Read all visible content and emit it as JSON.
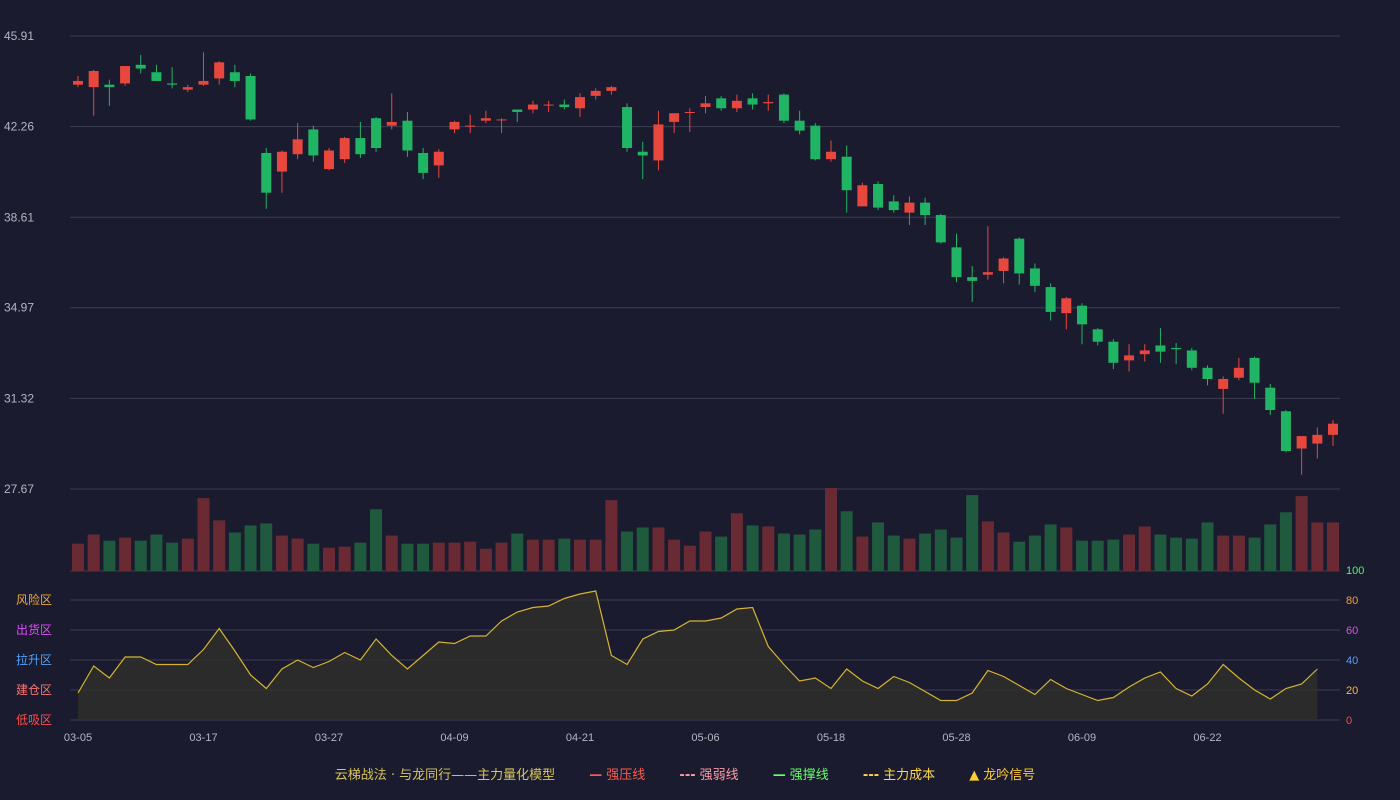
{
  "chart_data": {
    "type": "candlestick",
    "x_ticks": [
      "03-05",
      "03-17",
      "03-27",
      "04-09",
      "04-21",
      "05-06",
      "05-18",
      "05-28",
      "06-09",
      "06-22"
    ],
    "price_ticks": [
      "45.91",
      "42.26",
      "38.61",
      "34.97",
      "31.32",
      "27.67"
    ],
    "price_range": [
      27.67,
      45.91
    ],
    "osc_ticks": [
      "100",
      "80",
      "60",
      "40",
      "20",
      "0"
    ],
    "osc_range": [
      0,
      100
    ],
    "zones": [
      "风险区",
      "出货区",
      "拉升区",
      "建仓区",
      "低吸区"
    ],
    "ohlc": [
      [
        43.95,
        44.1,
        44.3,
        43.85
      ],
      [
        43.85,
        44.5,
        44.55,
        42.7
      ],
      [
        43.95,
        43.85,
        44.15,
        43.1
      ],
      [
        44.0,
        44.7,
        44.7,
        43.9
      ],
      [
        44.75,
        44.6,
        45.15,
        44.4
      ],
      [
        44.45,
        44.1,
        44.75,
        44.1
      ],
      [
        44.0,
        43.95,
        44.65,
        43.8
      ],
      [
        43.75,
        43.85,
        43.95,
        43.65
      ],
      [
        43.95,
        44.1,
        45.25,
        43.9
      ],
      [
        44.2,
        44.85,
        44.9,
        43.95
      ],
      [
        44.45,
        44.1,
        44.75,
        43.85
      ],
      [
        44.3,
        42.55,
        44.4,
        42.5
      ],
      [
        41.2,
        39.6,
        41.4,
        38.95
      ],
      [
        40.45,
        41.25,
        41.3,
        39.6
      ],
      [
        41.15,
        41.75,
        42.4,
        40.95
      ],
      [
        42.15,
        41.1,
        42.3,
        40.85
      ],
      [
        40.55,
        41.3,
        41.4,
        40.5
      ],
      [
        40.95,
        41.8,
        41.85,
        40.8
      ],
      [
        41.8,
        41.15,
        42.45,
        41.0
      ],
      [
        42.6,
        41.4,
        42.65,
        41.25
      ],
      [
        42.3,
        42.45,
        43.6,
        42.15
      ],
      [
        42.5,
        41.3,
        42.85,
        41.05
      ],
      [
        41.2,
        40.4,
        41.4,
        40.15
      ],
      [
        40.7,
        41.25,
        41.35,
        40.2
      ],
      [
        42.15,
        42.45,
        42.5,
        42.0
      ],
      [
        42.3,
        42.3,
        42.75,
        42.0
      ],
      [
        42.5,
        42.6,
        42.9,
        42.4
      ],
      [
        42.55,
        42.55,
        42.6,
        42.0
      ],
      [
        42.95,
        42.85,
        42.95,
        42.45
      ],
      [
        42.95,
        43.15,
        43.3,
        42.8
      ],
      [
        43.15,
        43.15,
        43.3,
        42.85
      ],
      [
        43.15,
        43.05,
        43.35,
        42.95
      ],
      [
        43.0,
        43.45,
        43.6,
        42.65
      ],
      [
        43.5,
        43.7,
        43.8,
        43.35
      ],
      [
        43.7,
        43.85,
        43.9,
        43.55
      ],
      [
        43.05,
        41.4,
        43.2,
        41.25
      ],
      [
        41.25,
        41.1,
        41.65,
        40.15
      ],
      [
        40.9,
        42.35,
        42.9,
        40.5
      ],
      [
        42.45,
        42.8,
        42.8,
        42.0
      ],
      [
        42.85,
        42.85,
        43.0,
        42.05
      ],
      [
        43.05,
        43.2,
        43.5,
        42.8
      ],
      [
        43.4,
        43.0,
        43.5,
        42.9
      ],
      [
        43.0,
        43.3,
        43.55,
        42.85
      ],
      [
        43.4,
        43.15,
        43.6,
        42.95
      ],
      [
        43.2,
        43.25,
        43.55,
        42.9
      ],
      [
        43.55,
        42.5,
        43.6,
        42.4
      ],
      [
        42.5,
        42.1,
        42.9,
        41.95
      ],
      [
        42.3,
        40.95,
        42.4,
        40.9
      ],
      [
        40.95,
        41.25,
        41.7,
        40.85
      ],
      [
        41.05,
        39.7,
        41.5,
        38.8
      ],
      [
        39.05,
        39.9,
        40.0,
        39.1
      ],
      [
        39.95,
        39.0,
        40.05,
        38.9
      ],
      [
        39.25,
        38.9,
        39.5,
        38.8
      ],
      [
        38.8,
        39.2,
        39.45,
        38.3
      ],
      [
        39.2,
        38.7,
        39.4,
        38.3
      ],
      [
        38.7,
        37.6,
        38.75,
        37.55
      ],
      [
        37.4,
        36.2,
        37.95,
        36.0
      ],
      [
        36.2,
        36.05,
        36.65,
        35.2
      ],
      [
        36.3,
        36.4,
        38.25,
        36.1
      ],
      [
        36.45,
        36.95,
        37.0,
        35.95
      ],
      [
        37.75,
        36.35,
        37.8,
        35.9
      ],
      [
        36.55,
        35.85,
        36.75,
        35.6
      ],
      [
        35.8,
        34.8,
        35.95,
        34.45
      ],
      [
        34.75,
        35.35,
        35.4,
        34.1
      ],
      [
        35.05,
        34.3,
        35.15,
        33.5
      ],
      [
        34.1,
        33.6,
        34.15,
        33.45
      ],
      [
        33.6,
        32.75,
        33.7,
        32.5
      ],
      [
        32.85,
        33.05,
        33.5,
        32.4
      ],
      [
        33.1,
        33.25,
        33.5,
        32.8
      ],
      [
        33.45,
        33.2,
        34.15,
        32.75
      ],
      [
        33.35,
        33.3,
        33.55,
        32.7
      ],
      [
        33.25,
        32.55,
        33.35,
        32.45
      ],
      [
        32.55,
        32.1,
        32.65,
        31.85
      ],
      [
        31.7,
        32.1,
        32.2,
        30.7
      ],
      [
        32.15,
        32.55,
        32.95,
        32.05
      ],
      [
        32.95,
        31.95,
        33.0,
        31.3
      ],
      [
        31.75,
        30.85,
        31.9,
        30.65
      ],
      [
        30.8,
        29.2,
        30.85,
        29.15
      ],
      [
        29.3,
        29.8,
        29.8,
        28.25
      ],
      [
        29.5,
        29.85,
        30.15,
        28.9
      ],
      [
        29.85,
        30.3,
        30.45,
        29.4
      ]
    ],
    "volume": [
      27,
      36,
      30,
      33,
      30,
      36,
      28,
      32,
      72,
      50,
      38,
      45,
      47,
      35,
      32,
      27,
      23,
      24,
      28,
      61,
      35,
      27,
      27,
      28,
      28,
      29,
      22,
      28,
      37,
      31,
      31,
      32,
      31,
      31,
      70,
      39,
      43,
      43,
      31,
      25,
      39,
      34,
      57,
      45,
      44,
      37,
      36,
      41,
      82,
      59,
      34,
      48,
      35,
      32,
      37,
      41,
      33,
      75,
      49,
      38,
      29,
      35,
      46,
      43,
      30,
      30,
      31,
      36,
      44,
      36,
      33,
      32,
      48,
      35,
      35,
      33,
      46,
      58,
      74,
      48,
      48
    ],
    "volume_max": 82,
    "oscillator": [
      18,
      36,
      28,
      42,
      42,
      37,
      37,
      37,
      47,
      61,
      46,
      30,
      21,
      34,
      40,
      35,
      39,
      45,
      40,
      54,
      43,
      34,
      43,
      52,
      51,
      56,
      56,
      66,
      72,
      75,
      76,
      81,
      84,
      86,
      43,
      37,
      54,
      59,
      60,
      66,
      66,
      68,
      74,
      75,
      49,
      37,
      26,
      28,
      21,
      34,
      26,
      21,
      29,
      25,
      19,
      13,
      13,
      18,
      33,
      29,
      23,
      17,
      27,
      21,
      17,
      13,
      15,
      22,
      28,
      32,
      21,
      16,
      24,
      37,
      28,
      20,
      14,
      21,
      24,
      34
    ],
    "colors": {
      "up": "#e8473e",
      "down": "#1fb564",
      "up_volume": "#6a2a33",
      "down_volume": "#1f5a3f",
      "oscillator_line": "#d6b42a",
      "oscillator_fill": "#2f2e2c",
      "grid": "#3c3e52"
    }
  },
  "legend": {
    "title": "云梯战法 · 与龙同行——主力量化模型",
    "items": [
      {
        "label": "强压线",
        "mark": "—",
        "color": "#ff5a4e"
      },
      {
        "label": "强弱线",
        "mark": "---",
        "color": "#ff9aa5"
      },
      {
        "label": "强撑线",
        "mark": "—",
        "color": "#66ff66"
      },
      {
        "label": "主力成本",
        "mark": "---",
        "color": "#ffd84a"
      },
      {
        "label": "龙吟信号",
        "mark": "▲",
        "color": "#ffcc33"
      }
    ]
  }
}
